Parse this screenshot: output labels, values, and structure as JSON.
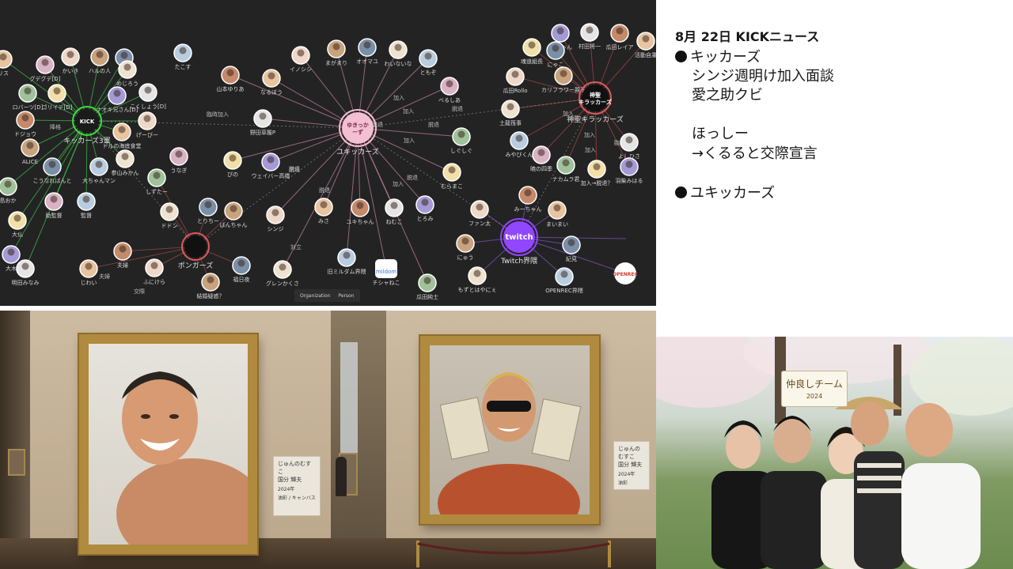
{
  "graph": {
    "hubs": {
      "kickers": {
        "label": "キッカーズ3軍",
        "badge": "KICK"
      },
      "yukkers": {
        "label": "ユキッカーズ",
        "badge": "ゆきっか\nーず"
      },
      "shinsei": {
        "label": "神聖キラッカーズ",
        "badge": "神聖\nキラッカーズ"
      },
      "bongers": {
        "label": "ボンガーズ"
      },
      "twitch": {
        "label": "Twitch界隈",
        "badge": "twitch"
      }
    },
    "nodes": [
      "リス",
      "かいき",
      "ハルの人",
      "ヤナ",
      "めじろう",
      "たこす",
      "グデグデ[D]",
      "ロバーツ[D]",
      "ゴリイデ[D]",
      "ナオキ兄さん[D]",
      "こくしょう[D]",
      "ドジョウ",
      "ドルの海底食堂",
      "げーびー",
      "ALICE",
      "こうなればんと",
      "参山みかん",
      "大ちゃんマン",
      "うなぎ",
      "しずたー",
      "ぴの",
      "ウェイバー高橋",
      "野田草履P",
      "山本ゆりあ",
      "なるぼう",
      "イノシシ",
      "まがまり",
      "オオマユ",
      "わいないな",
      "ともぞ",
      "べるしあ",
      "しぐしぐ",
      "むらまこ",
      "とろみ",
      "ねむこ",
      "ユキちゃん",
      "みさ",
      "シンジ",
      "ばんちゃん",
      "とりちー",
      "ドドン",
      "監督",
      "助監督",
      "島おか",
      "大仏",
      "大木",
      "明田みなみ",
      "夫婦",
      "じわい",
      "ふにけら",
      "結婚疑惑？",
      "福日夜",
      "グレンかくさ",
      "旧ミルダム界隈",
      "チシャねこ",
      "瓜田純士",
      "魂道組長",
      "AFちゃん",
      "村田将一",
      "瓜田レイア",
      "活動自粛",
      "瓜田Rollo",
      "カリフラワー親子",
      "にゃこ",
      "土龍筏事",
      "みやびくん",
      "暁の四季",
      "ナカムラ君",
      "加入→脱退？",
      "羽柴みはる",
      "よしひさ",
      "みーちゃん",
      "まいまい",
      "ファン太",
      "にゅう",
      "紀見",
      "もずとはやにぇ",
      "OPENREC界隈"
    ],
    "edge_labels": [
      "加入",
      "脱退",
      "加入",
      "脱退",
      "加入",
      "脱退",
      "臨時加入",
      "降格",
      "脱退",
      "対立",
      "夫婦",
      "交際",
      "加入",
      "加入",
      "脱退",
      "脱退",
      "加入",
      "脱退",
      "加入",
      "臨時招聘"
    ],
    "legend": {
      "organization": "Organization",
      "person": "Person"
    },
    "logos": {
      "mildom": "mildom",
      "openrec": "OPENREC"
    }
  },
  "news": {
    "date": "8月 22日 KICKニュース",
    "lines": [
      {
        "text": "キッカーズ",
        "bullet": true
      },
      {
        "text": "シンジ週明け加入面談",
        "bullet": false
      },
      {
        "text": "愛之助クビ",
        "bullet": false
      },
      {
        "text": "ほっしー",
        "bullet": false
      },
      {
        "text": "→くるると交際宣言",
        "bullet": false
      },
      {
        "text": "ユキッカーズ",
        "bullet": true
      }
    ]
  },
  "museum": {
    "placard_left": {
      "title": "じゅんのむすこ",
      "name": "国分 輝夫",
      "detail1": "2024年",
      "detail2": "油彩 / キャンバス"
    },
    "placard_right": {
      "title": "じゅんのむすこ",
      "name": "国分 輝夫",
      "detail1": "2024年",
      "detail2": "油彩"
    }
  },
  "park": {
    "sign_title": "仲良しチーム",
    "sign_year": "2024"
  }
}
